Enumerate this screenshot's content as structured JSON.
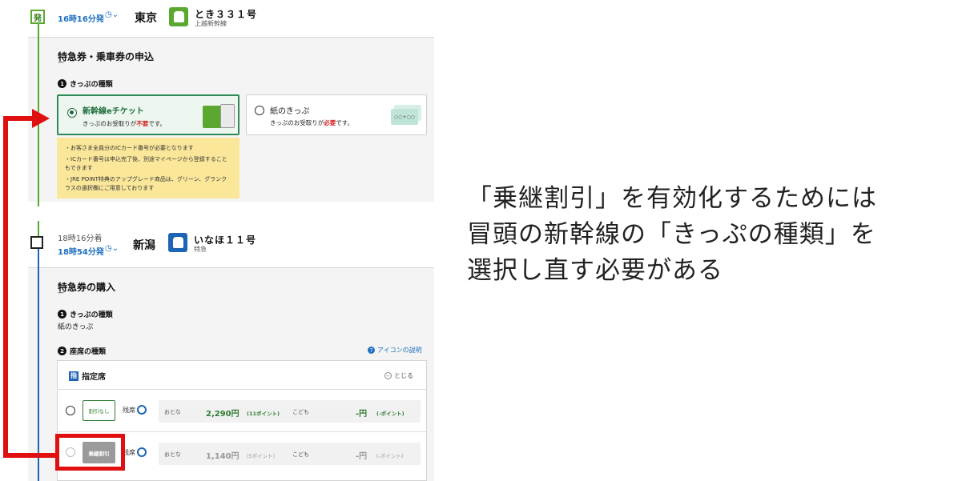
{
  "segment1": {
    "badge": "発",
    "departure": "16時16分発",
    "clock_icon": "clock-icon",
    "station": "東京",
    "train_name": "とき３３１号",
    "train_line": "上越新幹線",
    "section_title": "特急券・乗車券の申込",
    "step1_label": "きっぷの種類",
    "option_eticket": {
      "title": "新幹線eチケット",
      "sub_pre": "きっぷのお受取りが",
      "sub_em": "不要",
      "sub_post": "です。"
    },
    "option_paper": {
      "title": "紙のきっぷ",
      "sub_pre": "きっぷのお受取りが",
      "sub_em": "必要",
      "sub_post": "です。"
    },
    "notices": [
      "・お客さま全員分のICカード番号が必要となります",
      "・ICカード番号は申込完了後、別途マイページから登録することもできます",
      "・JRE POINT特典のアップグレード商品は、グリーン、グランクラスの選択欄にご用意しております"
    ]
  },
  "segment2": {
    "arrival": "18時16分着",
    "departure": "18時54分発",
    "station": "新潟",
    "train_name": "いなほ１１号",
    "train_type": "特急",
    "section_title": "特急券の購入",
    "step1_label": "きっぷの種類",
    "step1_value": "紙のきっぷ",
    "step2_label": "座席の種類",
    "help_link": "アイコンの説明",
    "seat_type_icon": "指",
    "seat_type": "指定席",
    "collapse_label": "とじる",
    "rows": [
      {
        "tag": "割引なし",
        "remain": "残席",
        "adult_label": "おとな",
        "adult_price": "2,290円",
        "adult_points": "(11ポイント)",
        "child_label": "こども",
        "child_price": "-円",
        "child_points": "(-ポイント)"
      },
      {
        "tag": "乗継割引",
        "remain": "残席",
        "adult_label": "おとな",
        "adult_price": "1,140円",
        "adult_points": "(5ポイント)",
        "child_label": "こども",
        "child_price": "-円",
        "child_points": "(-ポイント)"
      }
    ]
  },
  "annotation_lines": [
    "「乗継割引」を有効化するためには",
    "冒頭の新幹線の「きっぷの種類」を",
    "選択し直す必要がある"
  ],
  "colors": {
    "green_line": "#5aa82f",
    "blue_line": "#1e64b4",
    "annotation_red": "#e01010",
    "notice_yellow": "#fbe79a"
  }
}
